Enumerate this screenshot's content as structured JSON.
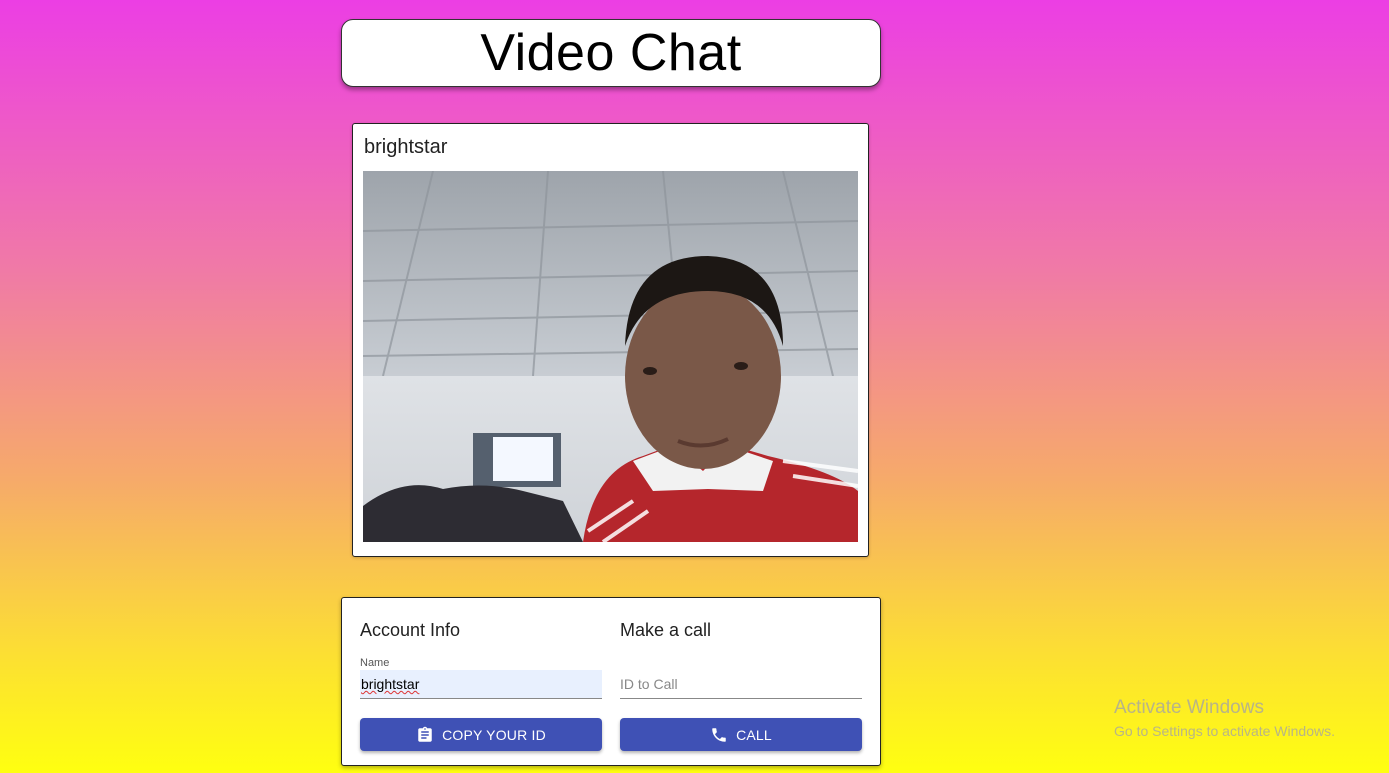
{
  "header": {
    "title": "Video Chat"
  },
  "video_panel": {
    "caller_name": "brightstar"
  },
  "account_info": {
    "heading": "Account Info",
    "name_label": "Name",
    "name_value": "brightstar",
    "copy_button_label": "COPY YOUR ID",
    "copy_icon": "clipboard-icon"
  },
  "make_call": {
    "heading": "Make a call",
    "id_placeholder": "ID to Call",
    "call_button_label": "CALL",
    "call_icon": "phone-icon",
    "button_color": "#3f51b5"
  },
  "watermark": {
    "line1": "Activate Windows",
    "line2": "Go to Settings to activate Windows."
  }
}
